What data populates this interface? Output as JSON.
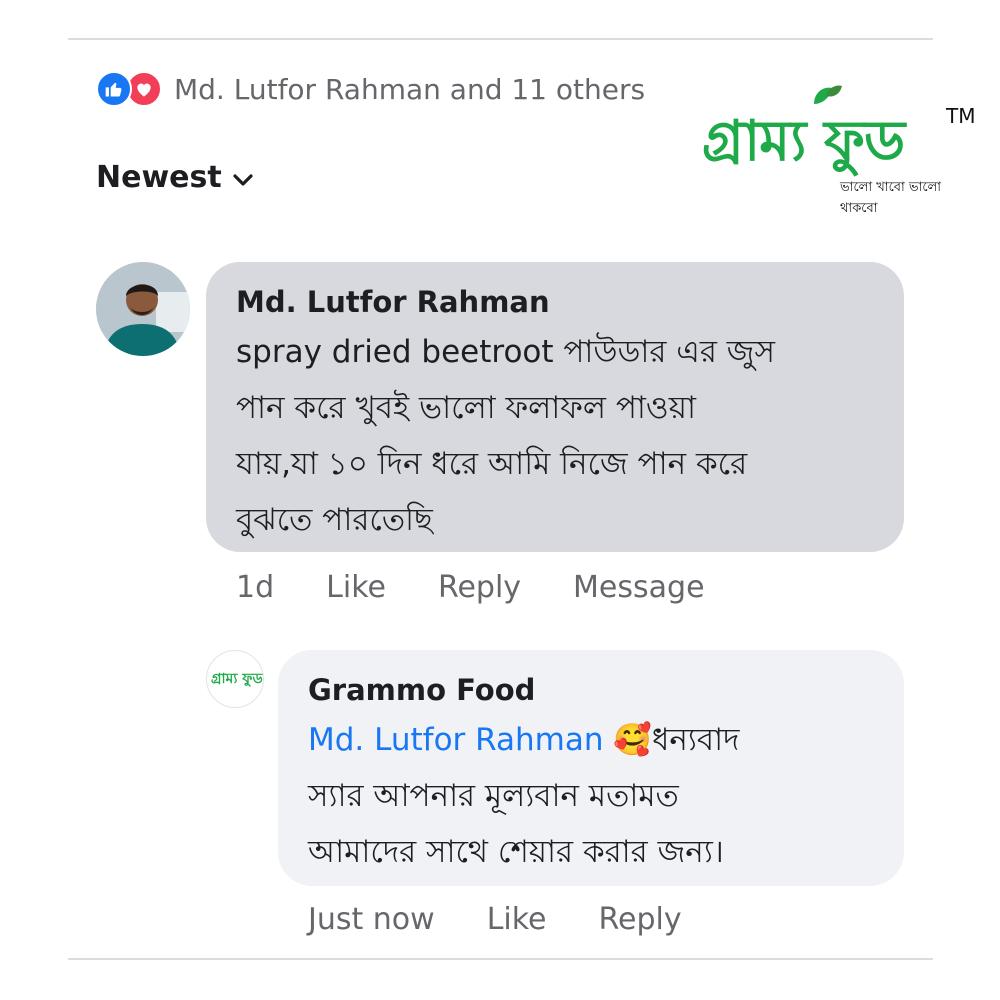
{
  "reactions": {
    "names": "Md. Lutfor Rahman and 11 others",
    "like_color": "#1877f2",
    "love_color": "#f33e58"
  },
  "sort": {
    "label": "Newest"
  },
  "brand": {
    "name": "গ্রাম্য ফুড",
    "tm": "TM",
    "tagline": "ভালো খাবো ভালো থাকবো",
    "color": "#1faa49"
  },
  "comment": {
    "author": "Md. Lutfor Rahman",
    "lines": [
      "spray dried beetroot পাউডার এর জুস",
      "পান করে খুবই ভালো ফলাফল পাওয়া",
      "যায়,যা ১০ দিন ধরে আমি নিজে পান করে",
      "বুঝতে পারতেছি"
    ],
    "actions": {
      "time": "1d",
      "like": "Like",
      "reply": "Reply",
      "message": "Message"
    }
  },
  "reply": {
    "author": "Grammo Food",
    "avatar_text": "গ্রাম্য ফুড",
    "mention": "Md. Lutfor Rahman",
    "emoji": "🥰",
    "line1_tail": "ধন্যবাদ",
    "lines": [
      "স্যার আপনার মূল্যবান মতামত",
      "আমাদের সাথে শেয়ার করার জন্য।"
    ],
    "actions": {
      "time": "Just now",
      "like": "Like",
      "reply": "Reply"
    }
  }
}
